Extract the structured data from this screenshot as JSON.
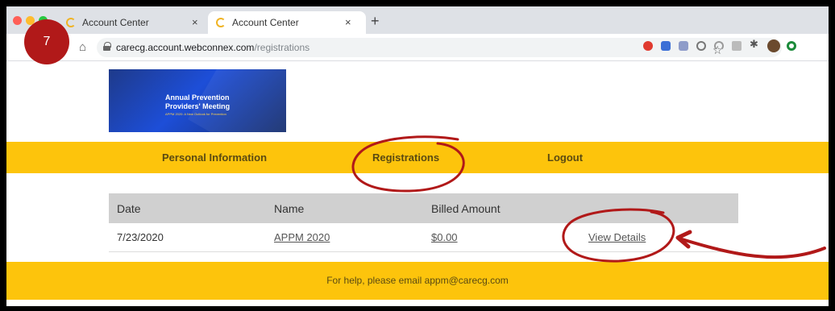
{
  "browser": {
    "tabs": [
      {
        "title": "Account Center"
      },
      {
        "title": "Account Center"
      }
    ],
    "tab_close_glyph": "×",
    "new_tab_glyph": "+",
    "url_host": "carecg.account.webconnex.com",
    "url_path": "/registrations"
  },
  "step_badge": "7",
  "banner": {
    "title": "Annual Prevention Providers' Meeting",
    "subtitle": "APPM 2020: A New Outlook for Prevention"
  },
  "nav": {
    "personal": "Personal Information",
    "registrations": "Registrations",
    "logout": "Logout"
  },
  "table": {
    "headers": [
      "Date",
      "Name",
      "Billed Amount"
    ],
    "rows": [
      {
        "date": "7/23/2020",
        "name": "APPM 2020",
        "amount": "$0.00",
        "action": "View Details"
      }
    ]
  },
  "footer": {
    "text": "For help, please email appm@carecg.com"
  },
  "colors": {
    "accent_yellow": "#fdc40c",
    "annotation_red": "#b11919",
    "banner_blue": "#1e3a8a"
  },
  "icons": {
    "home": "home-icon",
    "lock": "lock-icon",
    "star": "star-icon"
  }
}
